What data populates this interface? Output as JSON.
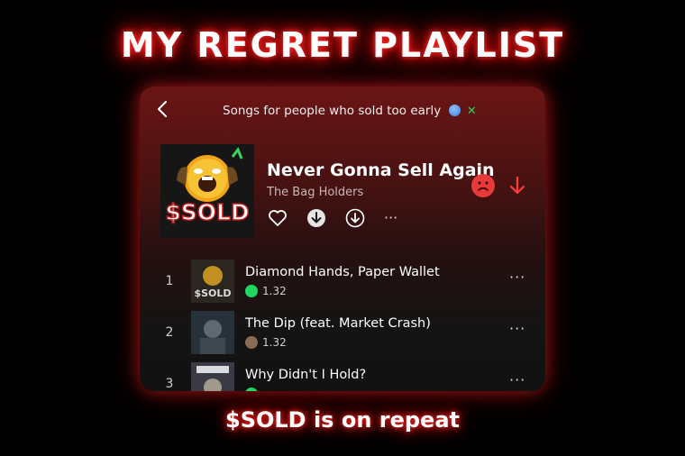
{
  "header": {
    "title": "MY REGRET PLAYLIST"
  },
  "card": {
    "subtitle": "Songs for people who sold too early",
    "back_icon": "chevron-left-icon",
    "now_playing": {
      "album_art_text": "$SOLD",
      "song_title": "Never Gonna Sell Again",
      "artist": "The Bag Holders",
      "actions": [
        "heart-icon",
        "download-filled-icon",
        "download-outline-icon",
        "more-icon"
      ],
      "right_actions": [
        "sad-face-icon",
        "arrow-down-icon"
      ]
    },
    "tracks": [
      {
        "number": "1",
        "title": "Diamond Hands, Paper Wallet",
        "meta": "1.32",
        "source_icon": "spotify-icon"
      },
      {
        "number": "2",
        "title": "The Dip (feat. Market Crash)",
        "meta": "1.32",
        "source_icon": "user-avatar-icon"
      },
      {
        "number": "3",
        "title": "Why Didn't I Hold?",
        "meta": "",
        "source_icon": "spotify-icon"
      }
    ],
    "more_label": "···"
  },
  "footer": {
    "text": "$SOLD is on repeat"
  },
  "colors": {
    "accent_red": "#e83a3a",
    "spotify_green": "#1ed760",
    "glow": "#ff2a2a"
  }
}
